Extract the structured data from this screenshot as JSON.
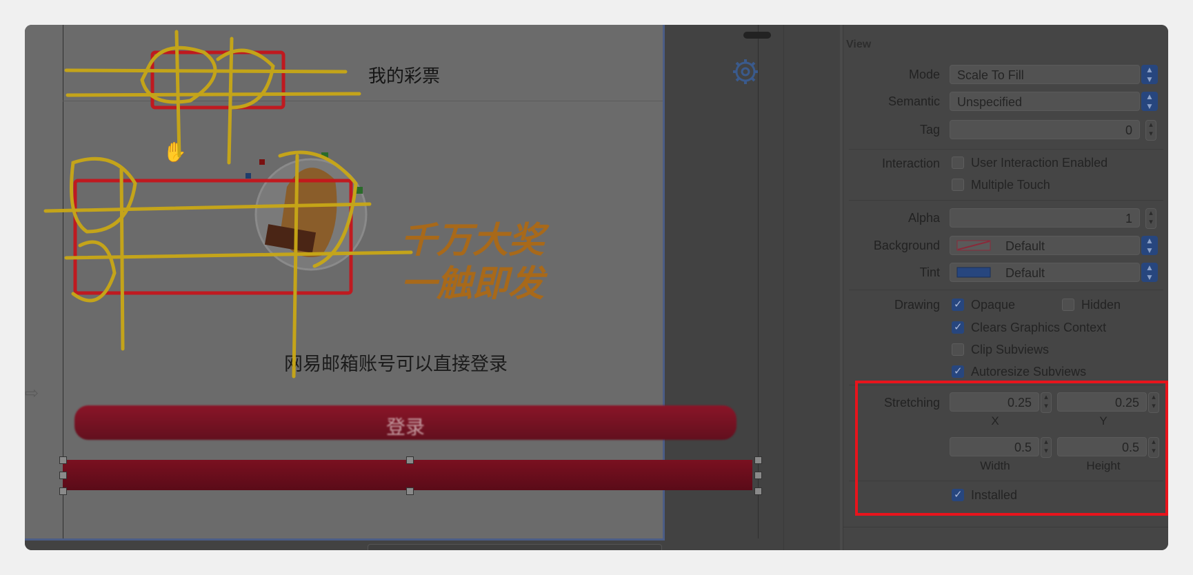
{
  "device": {
    "nav_title": "我的彩票",
    "promo_line1": "千万大奖",
    "promo_line2": "一触即发",
    "hint": "网易邮箱账号可以直接登录",
    "login_button": "登录"
  },
  "icons": {
    "settings": "gear-icon",
    "cursor": "hand-cursor-icon"
  },
  "inspector": {
    "section_title": "View",
    "mode": {
      "label": "Mode",
      "value": "Scale To Fill"
    },
    "semantic": {
      "label": "Semantic",
      "value": "Unspecified"
    },
    "tag": {
      "label": "Tag",
      "value": "0"
    },
    "interaction": {
      "label": "Interaction",
      "user_interaction": "User Interaction Enabled",
      "multiple_touch": "Multiple Touch"
    },
    "alpha": {
      "label": "Alpha",
      "value": "1"
    },
    "background": {
      "label": "Background",
      "value": "Default"
    },
    "tint": {
      "label": "Tint",
      "value": "Default"
    },
    "drawing": {
      "label": "Drawing",
      "opaque": "Opaque",
      "hidden": "Hidden",
      "clears": "Clears Graphics Context",
      "clip": "Clip Subviews",
      "autoresize": "Autoresize Subviews"
    },
    "stretching": {
      "label": "Stretching",
      "x": "0.25",
      "y": "0.25",
      "width": "0.5",
      "height": "0.5",
      "x_label": "X",
      "y_label": "Y",
      "width_label": "Width",
      "height_label": "Height"
    },
    "installed": "Installed"
  },
  "colors": {
    "highlight": "#e8141c",
    "accent": "#27467e",
    "scribble": "#c9a816"
  }
}
